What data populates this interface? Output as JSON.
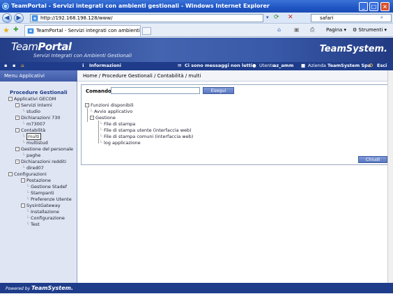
{
  "window": {
    "title": "TeamPortal - Servizi integrati con ambienti gestionali - Windows Internet Explorer",
    "minimize": "_",
    "maximize": "□",
    "close": "×"
  },
  "browser": {
    "back": "◀",
    "forward": "▶",
    "address": "http://192.168.198.128/www/",
    "search_value": "safari",
    "tab_title": "TeamPortal - Servizi integrati con ambienti gestionali",
    "page_menu": "Pagina",
    "tools_menu": "Strumenti"
  },
  "banner": {
    "logo_team": "Team",
    "logo_portal": "Portal",
    "subtitle": "Servizi Integrati con Ambienti Gestionali",
    "brand": "TeamSystem."
  },
  "menubar": {
    "informazioni": "Informazioni",
    "messaggi": "Ci sono messaggi non letti",
    "utente_label": "Utente",
    "utente_value": "az_amm",
    "azienda_label": "Azienda",
    "azienda_value": "TeamSystem Spa",
    "esci": "Esci"
  },
  "sidebar": {
    "header": "Menu Applicativi",
    "footer_prefix": "Powered by",
    "footer_brand": "TeamSystem.",
    "tree": [
      {
        "label": "Procedure Gestionali",
        "level": 0,
        "bold": true
      },
      {
        "label": "Applicativi GECOM",
        "level": 1,
        "box": "-"
      },
      {
        "label": "Servizi Interni",
        "level": 2,
        "box": "-"
      },
      {
        "label": "studio",
        "level": 3
      },
      {
        "label": "Dichiarazioni 730",
        "level": 2,
        "box": "-"
      },
      {
        "label": "m73007",
        "level": 3
      },
      {
        "label": "Contabilità",
        "level": 2,
        "box": "-"
      },
      {
        "label": "multi",
        "level": 3,
        "selected": true
      },
      {
        "label": "multistud",
        "level": 3
      },
      {
        "label": "Gestione del personale",
        "level": 2,
        "box": "-"
      },
      {
        "label": "paghe",
        "level": 3
      },
      {
        "label": "Dichiarazioni redditi",
        "level": 2,
        "box": "-"
      },
      {
        "label": "dired07",
        "level": 3
      },
      {
        "label": "Configurazioni",
        "level": 1,
        "box": "-"
      },
      {
        "label": "Postazione",
        "level": 2,
        "box": "-"
      },
      {
        "label": "Gestione Stadef",
        "level": 3
      },
      {
        "label": "Stampanti",
        "level": 3
      },
      {
        "label": "Preferenze Utente",
        "level": 3
      },
      {
        "label": "SysintGateway",
        "level": 2,
        "box": "-"
      },
      {
        "label": "Installazione",
        "level": 3
      },
      {
        "label": "Configurazione",
        "level": 3
      },
      {
        "label": "Test",
        "level": 3
      }
    ]
  },
  "breadcrumb": "Home / Procedure Gestionali / Contabilità / multi",
  "command": {
    "label": "Comando :",
    "value": "",
    "execute": "Esegui"
  },
  "functions": {
    "root": "Funzioni disponibili",
    "avvio": "Avvio applicativo",
    "gestione": "Gestione",
    "items": [
      "File di stampa",
      "File di stampa utente (interfaccia web)",
      "File di stampa comuni (interfaccia web)",
      "log applicazione"
    ]
  },
  "close_button": "Chiudi"
}
